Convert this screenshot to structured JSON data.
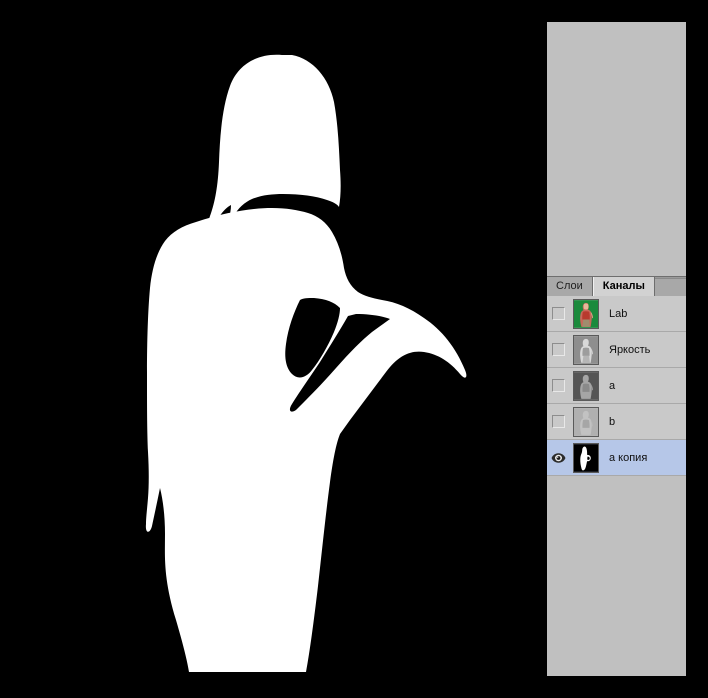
{
  "app": {
    "document_background": "#000000",
    "panel_background": "#c0c0c0",
    "list_background": "#c9c9c9",
    "selection_color": "#b6c7e8"
  },
  "canvas": {
    "name": "channel-mask-preview",
    "description": "Белый силуэт женщины на чёрном фоне",
    "mask_color": "#ffffff",
    "background_color": "#000000"
  },
  "panel": {
    "tabs": [
      {
        "label": "Слои",
        "active": false,
        "name": "tab-layers"
      },
      {
        "label": "Каналы",
        "active": true,
        "name": "tab-channels"
      }
    ],
    "channels": [
      {
        "label": "Lab",
        "visible": false,
        "selected": false,
        "thumb_type": "color",
        "thumb_bg": "#1b8a3c"
      },
      {
        "label": "Яркость",
        "visible": false,
        "selected": false,
        "thumb_type": "gray-light",
        "thumb_bg": "#8e8e8e"
      },
      {
        "label": "a",
        "visible": false,
        "selected": false,
        "thumb_type": "gray-dark",
        "thumb_bg": "#555555"
      },
      {
        "label": "b",
        "visible": false,
        "selected": false,
        "thumb_type": "gray-pale",
        "thumb_bg": "#b0b0b0"
      },
      {
        "label": "а копия",
        "visible": true,
        "selected": true,
        "thumb_type": "mask",
        "thumb_bg": "#000000"
      }
    ]
  },
  "icons": {
    "eye": "eye-icon",
    "visibility_checkbox": "visibility-checkbox"
  }
}
